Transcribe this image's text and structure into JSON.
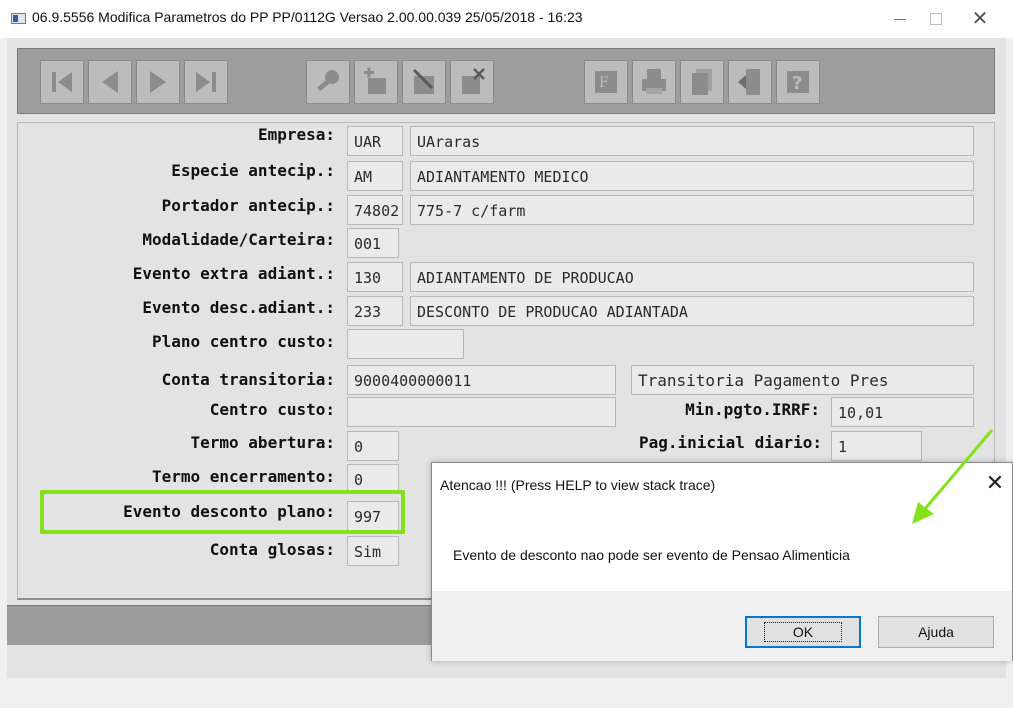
{
  "window": {
    "title": "06.9.5556  Modifica Parametros do PP PP/0112G Versao 2.00.00.039 25/05/2018 - 16:23",
    "close_glyph": "✕"
  },
  "toolbar": {
    "buttons": [
      "first-record-icon",
      "previous-record-icon",
      "next-record-icon",
      "last-record-icon",
      "search-key-icon",
      "add-record-icon",
      "edit-record-icon",
      "delete-record-icon",
      "filter-icon",
      "print-icon",
      "copy-icon",
      "exit-icon",
      "help-icon"
    ]
  },
  "form": {
    "empresa": {
      "label": "Empresa:",
      "code": "UAR",
      "desc": "UAraras"
    },
    "especie": {
      "label": "Especie antecip.:",
      "code": "AM",
      "desc": "ADIANTAMENTO MEDICO"
    },
    "portador": {
      "label": "Portador antecip.:",
      "code": "74802",
      "desc": "775-7 c/farm"
    },
    "modalidade": {
      "label": "Modalidade/Carteira:",
      "code": "001"
    },
    "evento_extra": {
      "label": "Evento extra adiant.:",
      "code": "130",
      "desc": "ADIANTAMENTO DE PRODUCAO"
    },
    "evento_desc": {
      "label": "Evento desc.adiant.:",
      "code": "233",
      "desc": "DESCONTO DE PRODUCAO ADIANTADA"
    },
    "plano_centro": {
      "label": "Plano centro custo:",
      "value": ""
    },
    "conta_transitoria": {
      "label": "Conta transitoria:",
      "code": "9000400000011",
      "desc": "Transitoria Pagamento Pres"
    },
    "centro_custo": {
      "label": "Centro custo:",
      "value": ""
    },
    "min_pgto": {
      "label": "Min.pgto.IRRF:",
      "value": "10,01"
    },
    "termo_abertura": {
      "label": "Termo abertura:",
      "value": "0"
    },
    "pag_inicial": {
      "label": "Pag.inicial diario:",
      "value": "1"
    },
    "termo_encerramento": {
      "label": "Termo encerramento:",
      "value": "0"
    },
    "evento_plano": {
      "label": "Evento desconto plano:",
      "value": "997"
    },
    "conta_glosas": {
      "label": "Conta glosas:",
      "value": "Sim"
    }
  },
  "dialog": {
    "title": "Atencao !!! (Press HELP to view stack trace)",
    "close_glyph": "✕",
    "message": "Evento de desconto nao pode ser evento de Pensao Alimenticia",
    "ok_label": "OK",
    "help_label": "Ajuda"
  },
  "colors": {
    "highlight": "#84e21b",
    "arrow": "#84e21b",
    "dialog_ok_border": "#0078d7"
  }
}
